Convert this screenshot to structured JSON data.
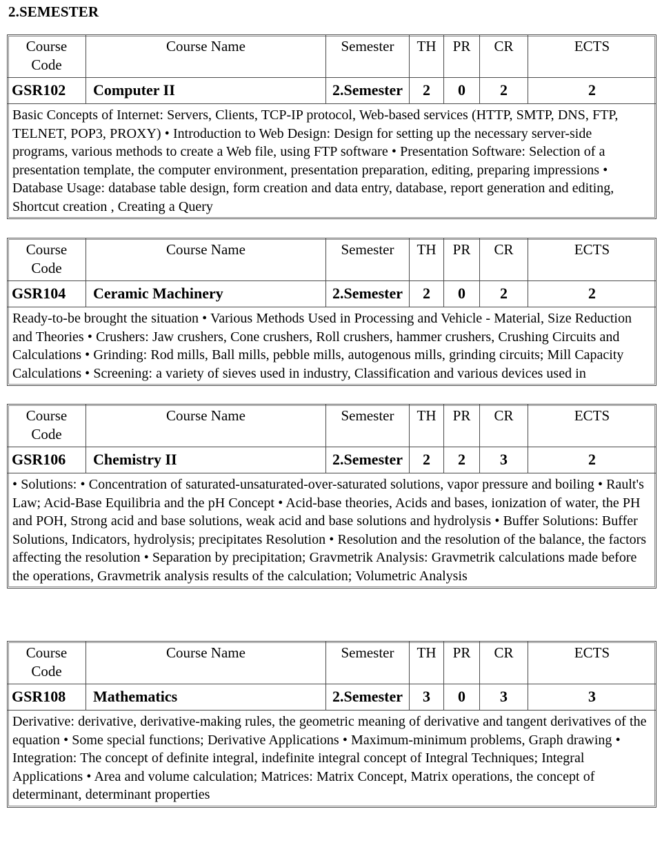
{
  "document": {
    "title": "2.SEMESTER"
  },
  "table_headers": {
    "course_code": "Course Code",
    "course_code_line1": "Course",
    "course_code_line2": "Code",
    "course_name": "Course Name",
    "semester": "Semester",
    "th": "TH",
    "pr": "PR",
    "cr": "CR",
    "ects": "ECTS"
  },
  "courses": [
    {
      "code": "GSR102",
      "name": "Computer II",
      "semester": "2.Semester",
      "th": "2",
      "pr": "0",
      "cr": "2",
      "ects": "2",
      "description": "Basic Concepts of Internet: Servers, Clients, TCP-IP protocol, Web-based services (HTTP, SMTP, DNS, FTP, TELNET, POP3, PROXY) • Introduction to Web Design: Design for setting up the necessary server-side programs, various methods to create a Web file, using FTP software • Presentation Software: Selection of a presentation template, the computer environment, presentation preparation, editing, preparing impressions • Database Usage: database table design, form creation and data entry, database, report generation and editing, Shortcut creation , Creating a Query"
    },
    {
      "code": "GSR104",
      "name": "Ceramic Machinery",
      "semester": "2.Semester",
      "th": "2",
      "pr": "0",
      "cr": "2",
      "ects": "2",
      "description": "Ready-to-be brought the situation • Various Methods Used in Processing and Vehicle - Material, Size Reduction and Theories • Crushers: Jaw crushers, Cone crushers, Roll crushers, hammer crushers, Crushing Circuits and Calculations • Grinding: Rod mills, Ball mills, pebble mills, autogenous mills, grinding circuits; Mill Capacity Calculations • Screening: a variety of sieves used in industry, Classification and various devices used in"
    },
    {
      "code": "GSR106",
      "name": "Chemistry  II",
      "semester": "2.Semester",
      "th": "2",
      "pr": "2",
      "cr": "3",
      "ects": "2",
      "description": "• Solutions: • Concentration of saturated-unsaturated-over-saturated solutions, vapor pressure and boiling • Rault's Law; Acid-Base Equilibria and the pH Concept • Acid-base theories, Acids and bases, ionization of water, the PH and POH, Strong acid and base solutions, weak acid and base solutions and hydrolysis • Buffer Solutions: Buffer Solutions, Indicators, hydrolysis; precipitates Resolution • Resolution and the resolution of the balance, the factors affecting the resolution • Separation by precipitation; Gravmetrik Analysis: Gravmetrik calculations made before the operations, Gravmetrik analysis results of the calculation; Volumetric Analysis"
    },
    {
      "code": "GSR108",
      "name": "Mathematics",
      "semester": "2.Semester",
      "th": "3",
      "pr": "0",
      "cr": "3",
      "ects": "3",
      "description": "Derivative: derivative, derivative-making rules, the geometric meaning of derivative and tangent derivatives of the equation • Some special functions; Derivative Applications • Maximum-minimum problems, Graph drawing • Integration: The concept of definite integral, indefinite integral concept of Integral Techniques; Integral Applications • Area and volume calculation; Matrices: Matrix Concept, Matrix operations, the concept of determinant, determinant properties"
    }
  ]
}
